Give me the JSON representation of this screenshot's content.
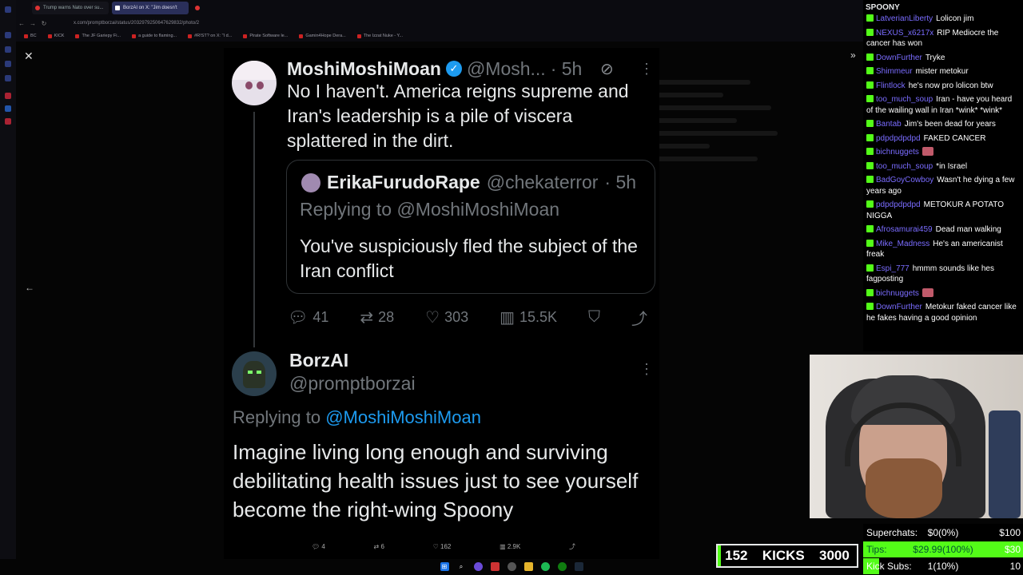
{
  "browser": {
    "tabs": [
      "Trump warns Nato over su...",
      "BorzAI on X: \"Jim doesn't",
      "+"
    ],
    "url": "x.com/promptborzai/status/2032979250647629832/photo/2",
    "bookmarks": [
      "BC",
      "KICK",
      "The JF Gariepy Fi...",
      "a guide to flaming...",
      "#R!ST? on X: \"I d...",
      "Pirate Software le...",
      "Gamin4Hope Dera...",
      "The Izzat Nuke - Y..."
    ]
  },
  "viewer": {
    "close_icon": "close-icon",
    "expand_icon": "chevron-right-icon",
    "prev_icon": "arrow-left-icon"
  },
  "tweet1": {
    "name": "MoshiMoshiMoan",
    "handle": "@Mosh...",
    "time": "· 5h",
    "text": "No I haven't.  America reigns supreme and Iran's leadership is a pile of viscera splattered in the dirt.",
    "quote": {
      "name": "ErikaFurudoRape",
      "handle": "@chekaterror",
      "time": "· 5h",
      "replying": "Replying to @MoshiMoshiMoan",
      "text": "You've suspiciously fled the subject of the Iran conflict"
    },
    "replies": "41",
    "reposts": "28",
    "likes": "303",
    "views": "15.5K"
  },
  "tweet2": {
    "name": "BorzAI",
    "handle": "@promptborzai",
    "replying_prefix": "Replying to",
    "replying_mention": "@MoshiMoshiMoan",
    "text": "Imagine living long enough and surviving debilitating health issues just to see yourself become the right-wing Spoony"
  },
  "bottom_stats": {
    "replies": "4",
    "reposts": "6",
    "likes": "162",
    "views": "2.9K"
  },
  "chat": {
    "top": "SPOONY",
    "messages": [
      {
        "user": "LatverianLiberty",
        "text": "Lolicon jim"
      },
      {
        "user": "NEXUS_x6217x",
        "text": "RIP Mediocre the cancer has won"
      },
      {
        "user": "DownFurther",
        "text": "Tryke"
      },
      {
        "user": "Shimmeur",
        "text": "mister metokur"
      },
      {
        "user": "Flintlock",
        "text": "he's now pro lolicon btw"
      },
      {
        "user": "too_much_soup",
        "text": "Iran - have you heard of the wailing wall in Iran *wink* *wink*"
      },
      {
        "user": "Bantab",
        "text": "Jim's been dead for years"
      },
      {
        "user": "pdpdpdpdpd",
        "text": "FAKED CANCER"
      },
      {
        "user": "bichnuggets",
        "text": "",
        "emote": true
      },
      {
        "user": "too_much_soup",
        "text": "*in Israel"
      },
      {
        "user": "BadGoyCowboy",
        "text": "Wasn't he dying a few years ago"
      },
      {
        "user": "pdpdpdpdpd",
        "text": "METOKUR A POTATO NIGGA"
      },
      {
        "user": "Afrosamurai459",
        "text": "Dead man walking"
      },
      {
        "user": "Mike_Madness",
        "text": "He's an americanist freak"
      },
      {
        "user": "Espi_777",
        "text": "hmmm sounds like hes fagposting"
      },
      {
        "user": "bichnuggets",
        "text": "",
        "emote": true
      },
      {
        "user": "DownFurther",
        "text": "Metokur faked cancer like he fakes having a good opinion"
      }
    ]
  },
  "kick_counter": {
    "count": "152",
    "label": "KICKS",
    "goal": "3000"
  },
  "goals": {
    "superchats": {
      "label": "Superchats:",
      "value": "$0(0%)",
      "max": "$100",
      "progress": 0
    },
    "tips": {
      "label": "Tips:",
      "value": "$29.99(100%)",
      "max": "$30",
      "progress": 1
    },
    "kick_subs": {
      "label": "Kick Subs:",
      "value": "1(10%)",
      "max": "10",
      "progress": 0.1
    }
  },
  "colors": {
    "accent": "#1d9bf0",
    "kick_green": "#53fc18",
    "chat_user": "#7a6cff"
  }
}
